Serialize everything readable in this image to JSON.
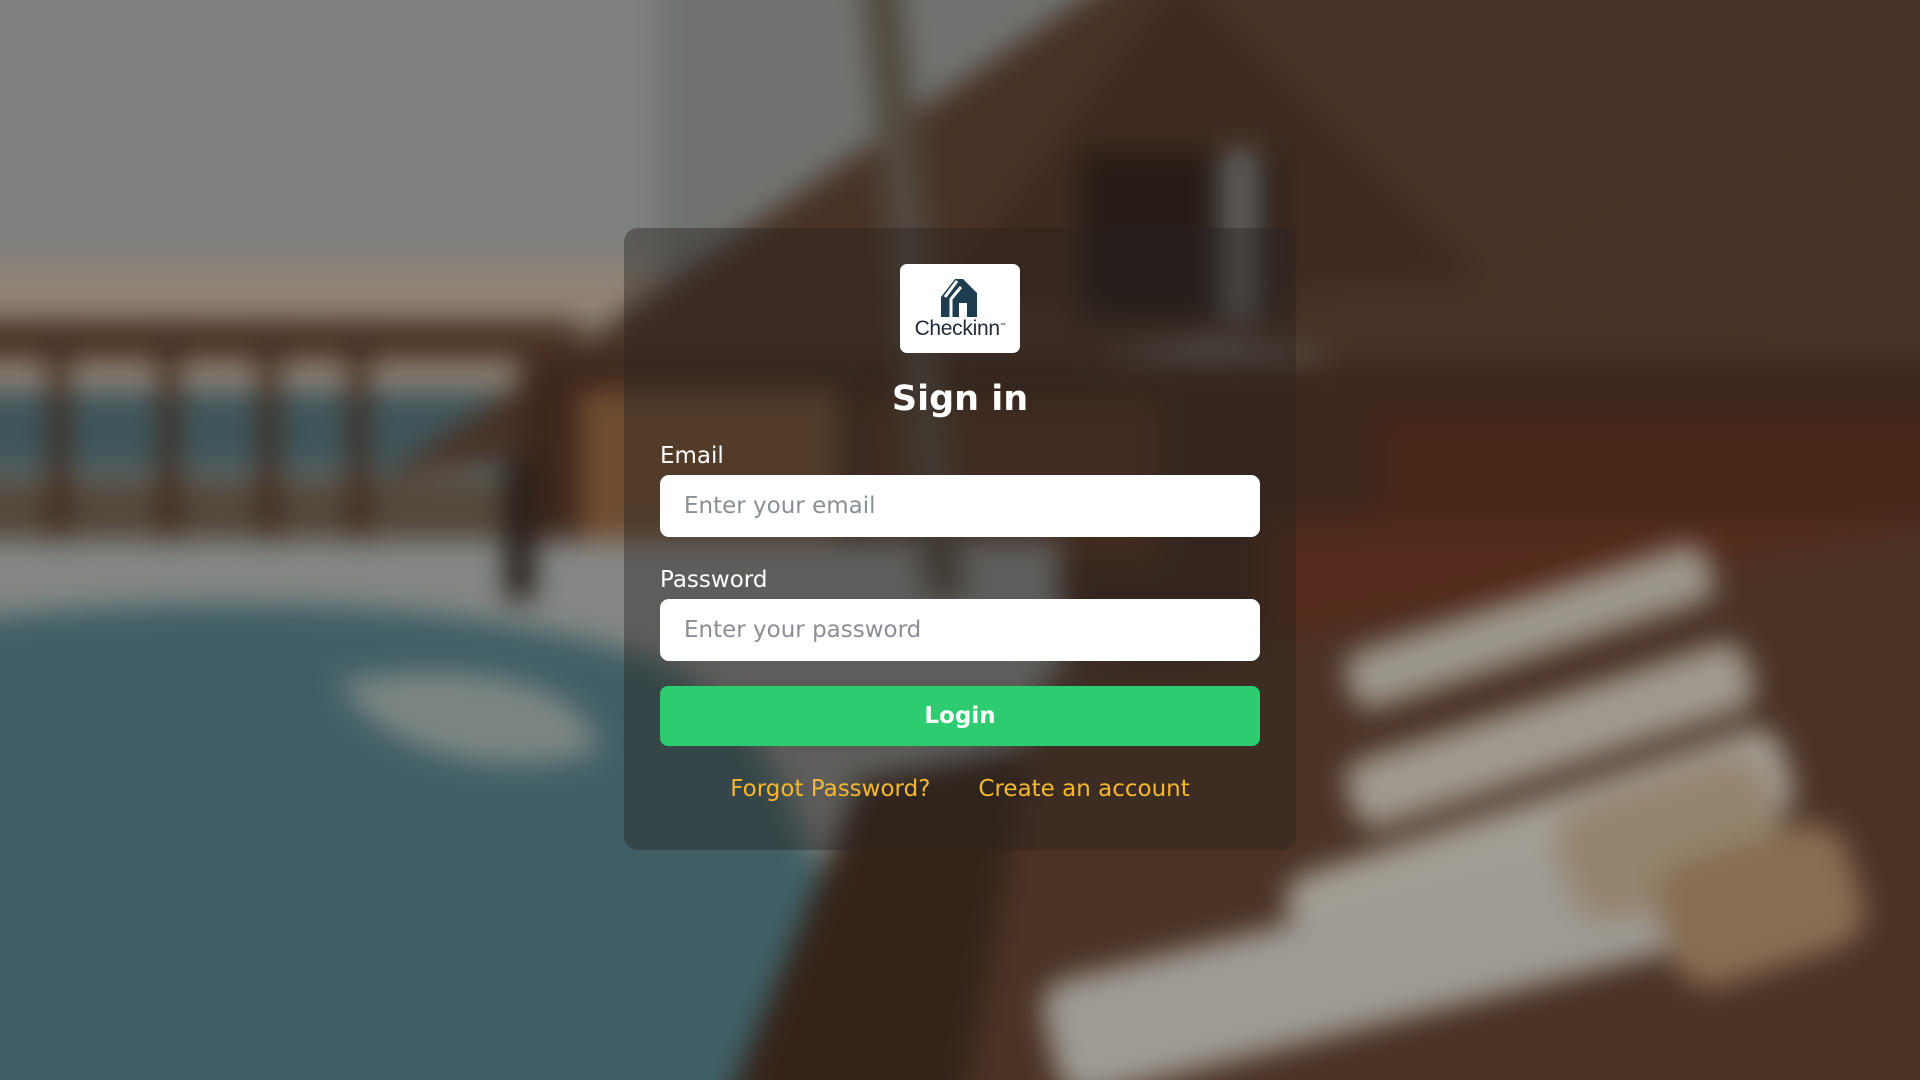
{
  "brand": {
    "logo_text": "Checkinn",
    "logo_tm": "™",
    "logo_color": "#1e2a3a"
  },
  "form": {
    "title": "Sign in",
    "email_label": "Email",
    "email_placeholder": "Enter your email",
    "email_value": "",
    "password_label": "Password",
    "password_placeholder": "Enter your password",
    "password_value": "",
    "login_label": "Login",
    "forgot_label": "Forgot Password?",
    "create_label": "Create an account"
  },
  "colors": {
    "login_button": "#2ecc71",
    "link": "#f5b82e",
    "card_overlay": "rgba(40,36,34,0.42)"
  },
  "background": {
    "description_icon": "resort-pool-photo"
  }
}
